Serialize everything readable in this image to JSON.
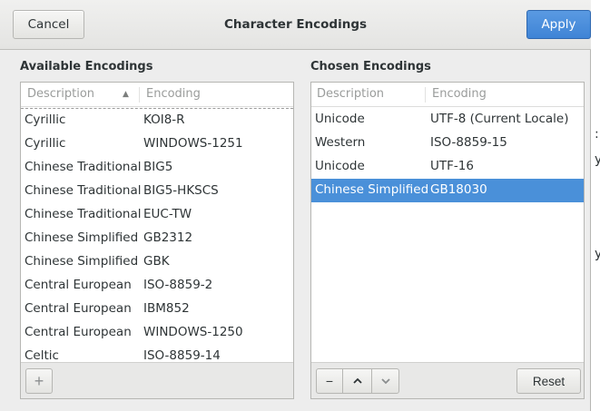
{
  "dialog": {
    "title": "Character Encodings",
    "cancel_label": "Cancel",
    "apply_label": "Apply"
  },
  "available": {
    "label": "Available Encodings",
    "col_description": "Description",
    "col_encoding": "Encoding",
    "rows": [
      {
        "description": "Cyrillic",
        "encoding": "KOI8-R"
      },
      {
        "description": "Cyrillic",
        "encoding": "WINDOWS-1251"
      },
      {
        "description": "Chinese Traditional",
        "encoding": "BIG5"
      },
      {
        "description": "Chinese Traditional",
        "encoding": "BIG5-HKSCS"
      },
      {
        "description": "Chinese Traditional",
        "encoding": "EUC-TW"
      },
      {
        "description": "Chinese Simplified",
        "encoding": "GB2312"
      },
      {
        "description": "Chinese Simplified",
        "encoding": "GBK"
      },
      {
        "description": "Central European",
        "encoding": "ISO-8859-2"
      },
      {
        "description": "Central European",
        "encoding": "IBM852"
      },
      {
        "description": "Central European",
        "encoding": "WINDOWS-1250"
      },
      {
        "description": "Celtic",
        "encoding": "ISO-8859-14"
      }
    ],
    "add_icon": "+"
  },
  "chosen": {
    "label": "Chosen Encodings",
    "col_description": "Description",
    "col_encoding": "Encoding",
    "rows": [
      {
        "description": "Unicode",
        "encoding": "UTF-8 (Current Locale)"
      },
      {
        "description": "Western",
        "encoding": "ISO-8859-15"
      },
      {
        "description": "Unicode",
        "encoding": "UTF-16"
      },
      {
        "description": "Chinese Simplified",
        "encoding": "GB18030"
      }
    ],
    "selected_row": 3,
    "remove_icon": "−",
    "reset_label": "Reset"
  },
  "colors": {
    "accent": "#4a90d9",
    "apply_button": "#3f84d6",
    "dialog_bg": "#ededed"
  }
}
